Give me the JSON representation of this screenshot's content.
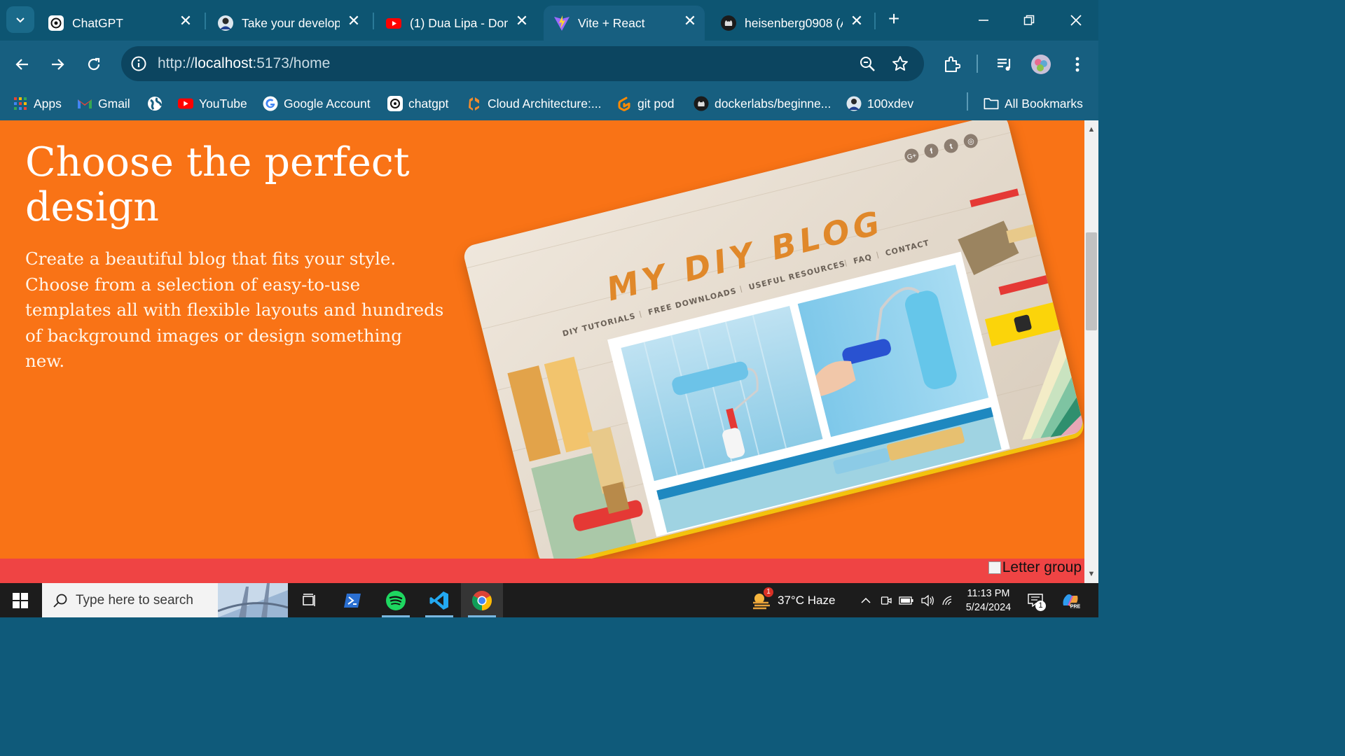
{
  "browser": {
    "tabs": [
      {
        "title": "ChatGPT",
        "icon": "chatgpt-icon",
        "active": false
      },
      {
        "title": "Take your develop",
        "icon": "avatar-icon",
        "active": false
      },
      {
        "title": "(1) Dua Lipa - Don",
        "icon": "youtube-icon",
        "active": false
      },
      {
        "title": "Vite + React",
        "icon": "vite-icon",
        "active": true
      },
      {
        "title": "heisenberg0908 (A",
        "icon": "github-icon",
        "active": false
      }
    ],
    "close_glyph": "✕",
    "new_tab_glyph": "+",
    "url_scheme": "http://",
    "url_host": "localhost",
    "url_rest": ":5173/home"
  },
  "bookmarks": {
    "items": [
      {
        "label": "Apps",
        "icon": "apps-grid-icon"
      },
      {
        "label": "Gmail",
        "icon": "gmail-icon"
      },
      {
        "label": "",
        "icon": "globe-icon"
      },
      {
        "label": "YouTube",
        "icon": "youtube-icon"
      },
      {
        "label": "Google Account",
        "icon": "google-icon"
      },
      {
        "label": "chatgpt",
        "icon": "chatgpt-icon"
      },
      {
        "label": "Cloud Architecture:...",
        "icon": "cloud-arch-icon"
      },
      {
        "label": "git pod",
        "icon": "gitpod-icon"
      },
      {
        "label": "dockerlabs/beginne...",
        "icon": "github-icon"
      },
      {
        "label": "100xdev",
        "icon": "avatar-icon"
      }
    ],
    "all_bookmarks": "All Bookmarks"
  },
  "page": {
    "heading": "Choose the perfect design",
    "body": "Create a beautiful blog that fits your style. Choose from a selection of easy-to-use templates all with flexible layouts and hundreds of background images or design something new.",
    "preview": {
      "logo": "MY DIY BLOG",
      "nav": [
        "DIY TUTORIALS",
        "FREE DOWNLOADS",
        "USEFUL RESOURCES",
        "FAQ",
        "CONTACT"
      ],
      "social": [
        "G+",
        "f",
        "t",
        "◎"
      ]
    },
    "broken_image_alt": "Letter group",
    "colors": {
      "background": "#f97316",
      "band": "#ef4444"
    }
  },
  "taskbar": {
    "search_placeholder": "Type here to search",
    "weather": "37°C  Haze",
    "weather_badge": "1",
    "time": "11:13 PM",
    "date": "5/24/2024",
    "notification_count": "1"
  }
}
